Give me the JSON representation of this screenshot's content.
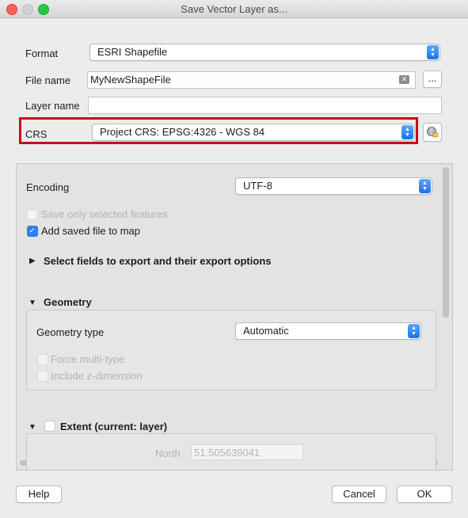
{
  "window": {
    "title": "Save Vector Layer as..."
  },
  "form": {
    "format_label": "Format",
    "format_value": "ESRI Shapefile",
    "filename_label": "File name",
    "filename_value": "MyNewShapeFile",
    "browse_label": "...",
    "layername_label": "Layer name",
    "layername_value": "",
    "crs_label": "CRS",
    "crs_value": "Project CRS: EPSG:4326 - WGS 84",
    "highlight_color": "#d0021b"
  },
  "options": {
    "encoding_label": "Encoding",
    "encoding_value": "UTF-8",
    "save_selected_label": "Save only selected features",
    "save_selected_checked": false,
    "add_to_map_label": "Add saved file to map",
    "add_to_map_checked": true,
    "select_fields_label": "Select fields to export and their export options",
    "geometry_section_label": "Geometry",
    "geometry_type_label": "Geometry type",
    "geometry_type_value": "Automatic",
    "force_multi_label": "Force multi-type",
    "include_z_label": "Include z-dimension",
    "extent_label": "Extent (current: layer)",
    "north_label": "North",
    "north_value": "51.505639041"
  },
  "buttons": {
    "help": "Help",
    "cancel": "Cancel",
    "ok": "OK"
  },
  "colors": {
    "accent": "#2f7cf6",
    "close": "#fe5f57",
    "minimize": "#febc2e",
    "zoom": "#28c840"
  },
  "icons": [
    "clear-text-icon",
    "crs-select-icon",
    "chevron-updown-icon",
    "expand-arrow-icon",
    "collapse-arrow-icon",
    "check-icon"
  ]
}
